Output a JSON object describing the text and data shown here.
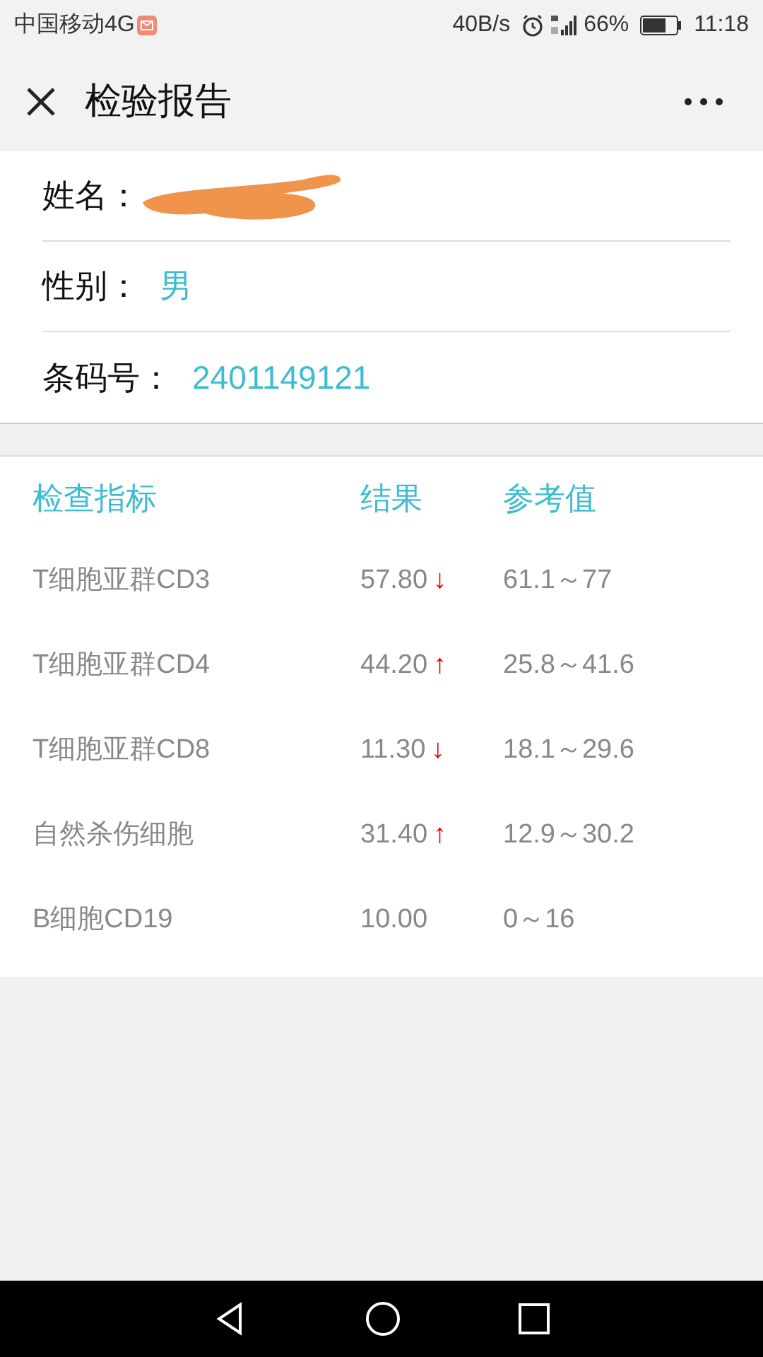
{
  "status_bar": {
    "carrier": "中国移动4G",
    "speed": "40B/s",
    "battery": "66%",
    "time": "11:18"
  },
  "header": {
    "title": "检验报告"
  },
  "patient": [
    {
      "label": "姓名：",
      "redacted": true
    },
    {
      "label": "性别：",
      "value": "男",
      "redacted": false
    },
    {
      "label": "条码号：",
      "value": "2401149121",
      "redacted": false
    }
  ],
  "table": {
    "columns": [
      "检查指标",
      "结果",
      "参考值"
    ],
    "rows": [
      {
        "name": "T细胞亚群CD3",
        "result": "57.80",
        "arrow": "↓",
        "range": "61.1～77"
      },
      {
        "name": "T细胞亚群CD4",
        "result": "44.20",
        "arrow": "↑",
        "range": "25.8～41.6"
      },
      {
        "name": "T细胞亚群CD8",
        "result": "11.30",
        "arrow": "↓",
        "range": "18.1～29.6"
      },
      {
        "name": "自然杀伤细胞",
        "result": "31.40",
        "arrow": "↑",
        "range": "12.9～30.2"
      },
      {
        "name": "B细胞CD19",
        "result": "10.00",
        "range": "0～16"
      }
    ]
  }
}
